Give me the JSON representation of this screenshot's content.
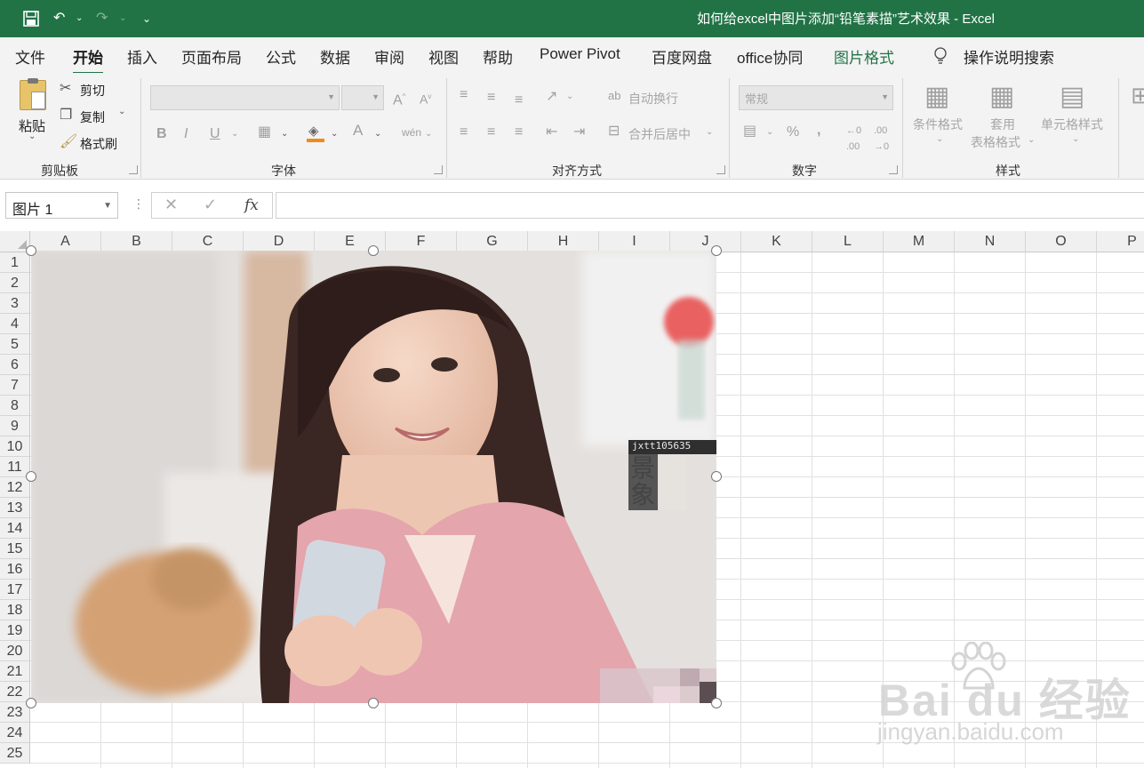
{
  "window": {
    "title": "如何给excel中图片添加“铅笔素描”艺术效果  -  Excel"
  },
  "tabs": [
    "文件",
    "开始",
    "插入",
    "页面布局",
    "公式",
    "数据",
    "审阅",
    "视图",
    "帮助",
    "Power Pivot",
    "百度网盘",
    "office协同",
    "图片格式",
    "操作说明搜索"
  ],
  "clipboard": {
    "paste": "粘贴",
    "cut": "剪切",
    "copy": "复制",
    "format_painter": "格式刷",
    "label": "剪贴板"
  },
  "font": {
    "label": "字体"
  },
  "alignment": {
    "wrap": "自动换行",
    "merge": "合并后居中",
    "label": "对齐方式"
  },
  "number": {
    "format": "常规",
    "label": "数字"
  },
  "styles": {
    "conditional": "条件格式",
    "table_line1": "套用",
    "table_line2": "表格格式",
    "cell_styles": "单元格样式",
    "label": "样式"
  },
  "formula_bar": {
    "name_box": "图片 1",
    "fx": "fx"
  },
  "columns": [
    "A",
    "B",
    "C",
    "D",
    "E",
    "F",
    "G",
    "H",
    "I",
    "J",
    "K",
    "L",
    "M",
    "N",
    "O",
    "P"
  ],
  "rows": [
    "1",
    "2",
    "3",
    "4",
    "5",
    "6",
    "7",
    "8",
    "9",
    "10",
    "11",
    "12",
    "13",
    "14",
    "15",
    "16",
    "17",
    "18",
    "19",
    "20",
    "21",
    "22",
    "23",
    "24",
    "25"
  ],
  "picture": {
    "stamp_text": "jxtt105635",
    "stamp_glyph": "景象"
  },
  "watermark": {
    "brand": "Bai du 经验",
    "url": "jingyan.baidu.com"
  }
}
